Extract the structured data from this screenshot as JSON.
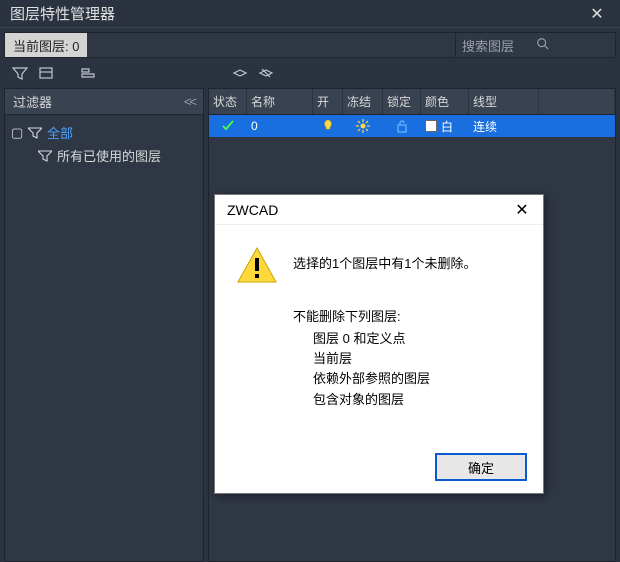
{
  "window": {
    "title": "图层特性管理器"
  },
  "current_layer": {
    "prefix": "当前图层:",
    "name": "0",
    "combined": "当前图层: 0"
  },
  "search": {
    "placeholder": "搜索图层"
  },
  "filter_panel": {
    "title": "过滤器",
    "tree": {
      "root": {
        "label": "全部"
      },
      "child": {
        "label": "所有已使用的图层"
      }
    }
  },
  "columns": {
    "state": "状态",
    "name": "名称",
    "on": "开",
    "freeze": "冻结",
    "lock": "锁定",
    "color": "颜色",
    "linetype": "线型"
  },
  "rows": [
    {
      "state_icon": "check",
      "name": "0",
      "on": true,
      "frozen": false,
      "locked": false,
      "color_name": "白",
      "color_hex": "#ffffff",
      "linetype": "连续",
      "selected": true
    }
  ],
  "dialog": {
    "title": "ZWCAD",
    "message": "选择的1个图层中有1个未删除。",
    "list_header": "不能删除下列图层:",
    "list_items": [
      "图层 0 和定义点",
      "当前层",
      "依赖外部参照的图层",
      "包含对象的图层"
    ],
    "ok_label": "确定"
  }
}
